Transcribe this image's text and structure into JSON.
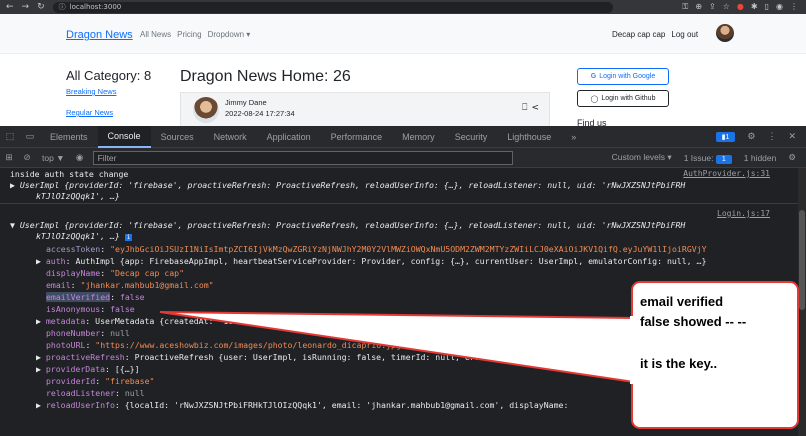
{
  "browser": {
    "url": "localhost:3000"
  },
  "navbar": {
    "brand": "Dragon News",
    "links": [
      "All News",
      "Pricing",
      "Dropdown ▾"
    ],
    "user_name": "Decap cap cap",
    "logout": "Log out"
  },
  "sidebar": {
    "title": "All Category: 8",
    "links": [
      "Breaking News",
      "Regular News"
    ]
  },
  "main": {
    "title": "Dragon News Home: 26",
    "author": "Jimmy Dane",
    "date": "2022-08-24 17:27:34"
  },
  "rightbar": {
    "google": "Login with Google",
    "github": "Login with Github",
    "find_us": "Find us"
  },
  "devtools": {
    "tabs": [
      "Elements",
      "Console",
      "Sources",
      "Network",
      "Application",
      "Performance",
      "Memory",
      "Security",
      "Lighthouse",
      "»"
    ],
    "active_tab": "Console",
    "issue_count": "1",
    "top": "top ▼",
    "filter_placeholder": "Filter",
    "levels": "Custom levels ▾",
    "issue_text": "1 Issue:",
    "hidden": "1 hidden"
  },
  "console": {
    "l1": "inside auth state change",
    "src1": "AuthProvider.js:31",
    "l2": "UserImpl {providerId: 'firebase', proactiveRefresh: ProactiveRefresh, reloadUserInfo: {…}, reloadListener: null, uid: 'rNwJXZSNJtPbiFRH",
    "l3": "kTJlOIzQQqk1', …}",
    "src2": "Login.js:17",
    "l4": "UserImpl {providerId: 'firebase', proactiveRefresh: ProactiveRefresh, reloadUserInfo: {…}, reloadListener: null, uid: 'rNwJXZSNJtPbiFRH",
    "l5": "kTJlOIzQQqk1', …}",
    "accessToken_key": "accessToken",
    "accessToken_val": "\"eyJhbGciOiJSUzI1NiIsImtpZCI6IjVkMzQwZGRiYzNjNWJhY2M0Y2VlMWZiOWQxNmU5ODM2ZWM2MTYzZWIiLCJ0eXAiOiJKV1QifQ.eyJuYW1lIjoiRGVjY",
    "auth_key": "auth",
    "auth_val": "AuthImpl {app: FirebaseAppImpl, heartbeatServiceProvider: Provider, config: {…}, currentUser: UserImpl, emulatorConfig: null, …}",
    "displayName_key": "displayName",
    "displayName_val": "\"Decap cap cap\"",
    "email_key": "email",
    "email_val": "\"jhankar.mahbub1@gmail.com\"",
    "emailVerified_key": "emailVerified",
    "emailVerified_val": "false",
    "isAnonymous_key": "isAnonymous",
    "isAnonymous_val": "false",
    "metadata_key": "metadata",
    "metadata_val": "UserMetadata {createdAt: '16662253",
    "phoneNumber_key": "phoneNumber",
    "phoneNumber_val": "null",
    "photoURL_key": "photoURL",
    "photoURL_val": "\"https://www.aceshowbiz.com/images/photo/leonardo_dicaprio.jpg\"",
    "proactiveRefresh_key": "proactiveRefresh",
    "proactiveRefresh_val": "ProactiveRefresh {user: UserImpl, isRunning: false, timerId: null, errorBacko",
    "providerData_key": "providerData",
    "providerData_val": "[{…}]",
    "providerId_key": "providerId",
    "providerId_val": "\"firebase\"",
    "reloadListener_key": "reloadListener",
    "reloadListener_val": "null",
    "reloadUserInfo_key": "reloadUserInfo",
    "reloadUserInfo_val": "{localId: 'rNwJXZSNJtPbiFRHkTJlOIzQQqk1', email: 'jhankar.mahbub1@gmail.com', displayName:"
  },
  "annotation": {
    "line1": "email verified",
    "line2": "false showed -- --",
    "line3": "it is the key.."
  }
}
